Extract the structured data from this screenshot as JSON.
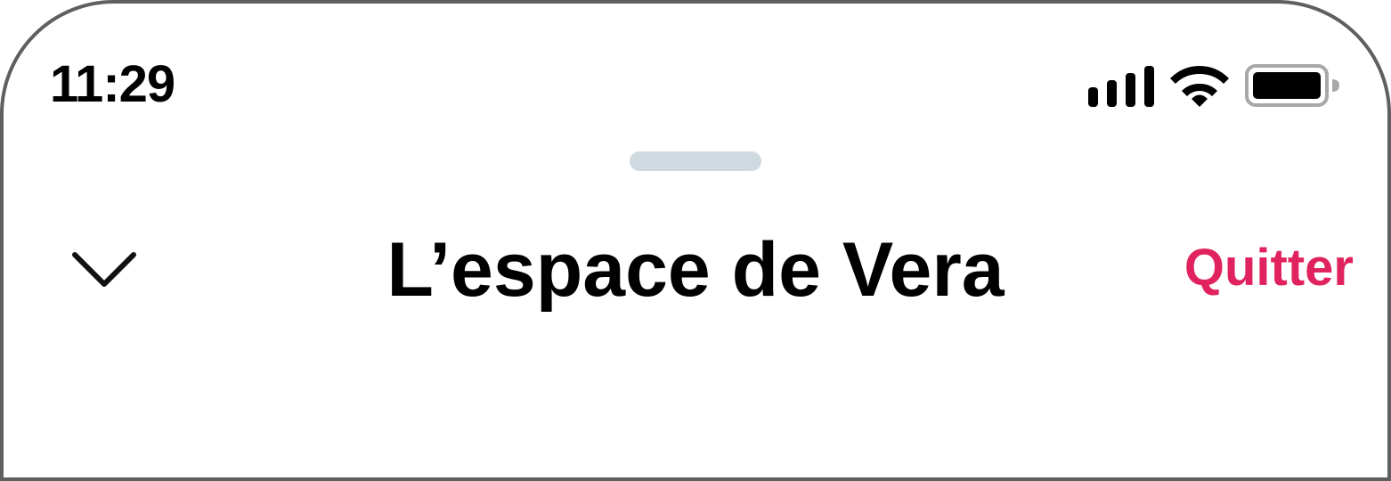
{
  "status_bar": {
    "time": "11:29",
    "icons": [
      "cellular-signal-icon",
      "wifi-icon",
      "battery-icon"
    ]
  },
  "sheet": {
    "title": "L’espace de Vera",
    "close_icon": "chevron-down-icon",
    "quit_label": "Quitter"
  },
  "colors": {
    "accent": "#e0225f",
    "grabber": "#cfd9e0",
    "frame": "#5f5f5f",
    "text": "#000000"
  }
}
